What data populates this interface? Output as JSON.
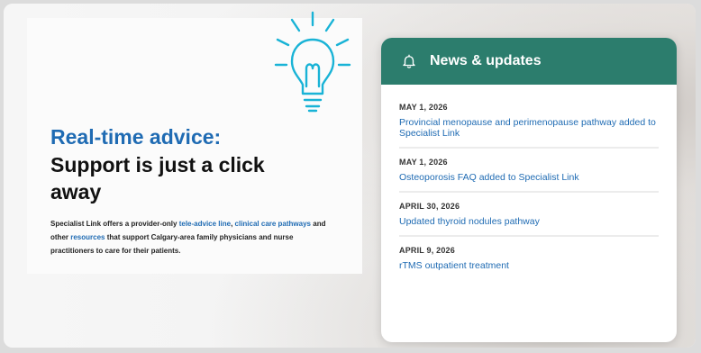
{
  "hero": {
    "title_accent": "Real-time advice:",
    "title": "Support is just a click away",
    "desc": {
      "part1": "Specialist Link offers a provider-only ",
      "link1": "tele-advice line",
      "sep1": ", ",
      "link2": "clinical care pathways",
      "part2": " and other ",
      "link3": "resources",
      "part3": " that support Calgary-area family physicians and nurse practitioners to care for their patients."
    }
  },
  "news": {
    "header_title": "News & updates",
    "icon": "bell-icon",
    "items": [
      {
        "date": "MAY 1, 2026",
        "title": "Provincial menopause and perimenopause pathway added to Specialist Link"
      },
      {
        "date": "MAY 1, 2026",
        "title": "Osteoporosis FAQ added to Specialist Link"
      },
      {
        "date": "APRIL 30, 2026",
        "title": "Updated thyroid nodules pathway"
      },
      {
        "date": "APRIL 9, 2026",
        "title": "rTMS outpatient treatment"
      }
    ]
  },
  "colors": {
    "accent_blue": "#1f6bb3",
    "header_teal": "#2c7d6d",
    "bulb_cyan": "#19b3d6"
  }
}
